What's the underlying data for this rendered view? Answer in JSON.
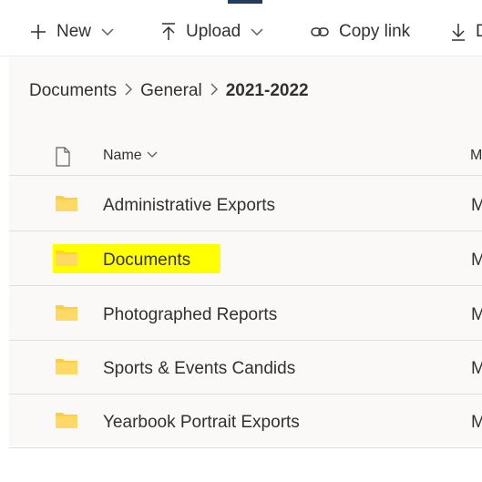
{
  "toolbar": {
    "new_label": "New",
    "upload_label": "Upload",
    "copy_link_label": "Copy link",
    "download_label": "D"
  },
  "breadcrumb": {
    "items": [
      "Documents",
      "General",
      "2021-2022"
    ]
  },
  "list": {
    "header_name": "Name",
    "header_modified": "M",
    "rows": [
      {
        "name": "Administrative Exports",
        "modified": "M",
        "highlighted": false
      },
      {
        "name": "Documents",
        "modified": "M",
        "highlighted": true
      },
      {
        "name": "Photographed Reports",
        "modified": "M",
        "highlighted": false
      },
      {
        "name": "Sports & Events Candids",
        "modified": "M",
        "highlighted": false
      },
      {
        "name": "Yearbook Portrait Exports",
        "modified": "M",
        "highlighted": false
      }
    ]
  },
  "colors": {
    "folder": "#ffce3d",
    "highlight": "#ffff00",
    "text": "#323130"
  },
  "icons": [
    "plus-icon",
    "chevron-down-icon",
    "upload-icon",
    "link-icon",
    "download-icon",
    "chevron-right-icon",
    "document-icon",
    "sort-chevron-icon",
    "folder-icon"
  ]
}
